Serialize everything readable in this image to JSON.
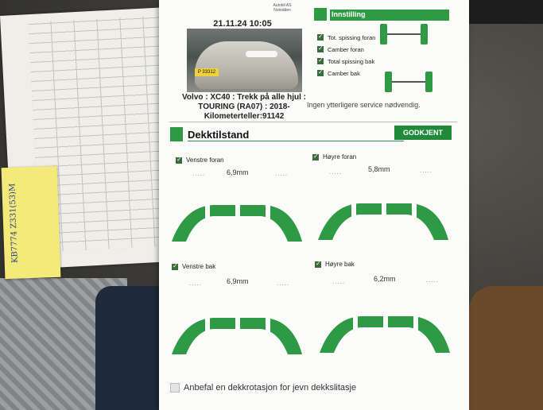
{
  "note": {
    "header_lines": [
      "Autobil AS",
      "Notodden"
    ],
    "datetime": "21.11.24 10:05",
    "plate": "P 33312",
    "car_info_lines": [
      "Volvo : XC40 : Trekk på alle hjul :",
      "TOURING (RA07) : 2018-",
      "Kilometerteller:91142"
    ]
  },
  "alignment": {
    "title": "Innstilling",
    "checks": [
      {
        "label": "Tot. spissing foran",
        "checked": true
      },
      {
        "label": "Camber foran",
        "checked": true
      },
      {
        "label": "Total spissing bak",
        "checked": true
      },
      {
        "label": "Camber bak",
        "checked": true
      }
    ],
    "service_text": "Ingen ytterligere service nødvendig."
  },
  "tires": {
    "title": "Dekktilstand",
    "status": "GODKJENT",
    "wheels": [
      {
        "label": "Venstre foran",
        "depth": "6,9mm"
      },
      {
        "label": "Høyre foran",
        "depth": "5,8mm"
      },
      {
        "label": "Venstre bak",
        "depth": "6,9mm"
      },
      {
        "label": "Høyre bak",
        "depth": "6,2mm"
      }
    ],
    "dots": "....."
  },
  "rotation": {
    "label": "Anbefal en dekkrotasjon for jevn dekkslitasje",
    "checked": false
  },
  "sticky": {
    "text": "KB7774 Z331(53)M"
  },
  "colors": {
    "green": "#2e9a44",
    "badge": "#1f8b3a"
  }
}
